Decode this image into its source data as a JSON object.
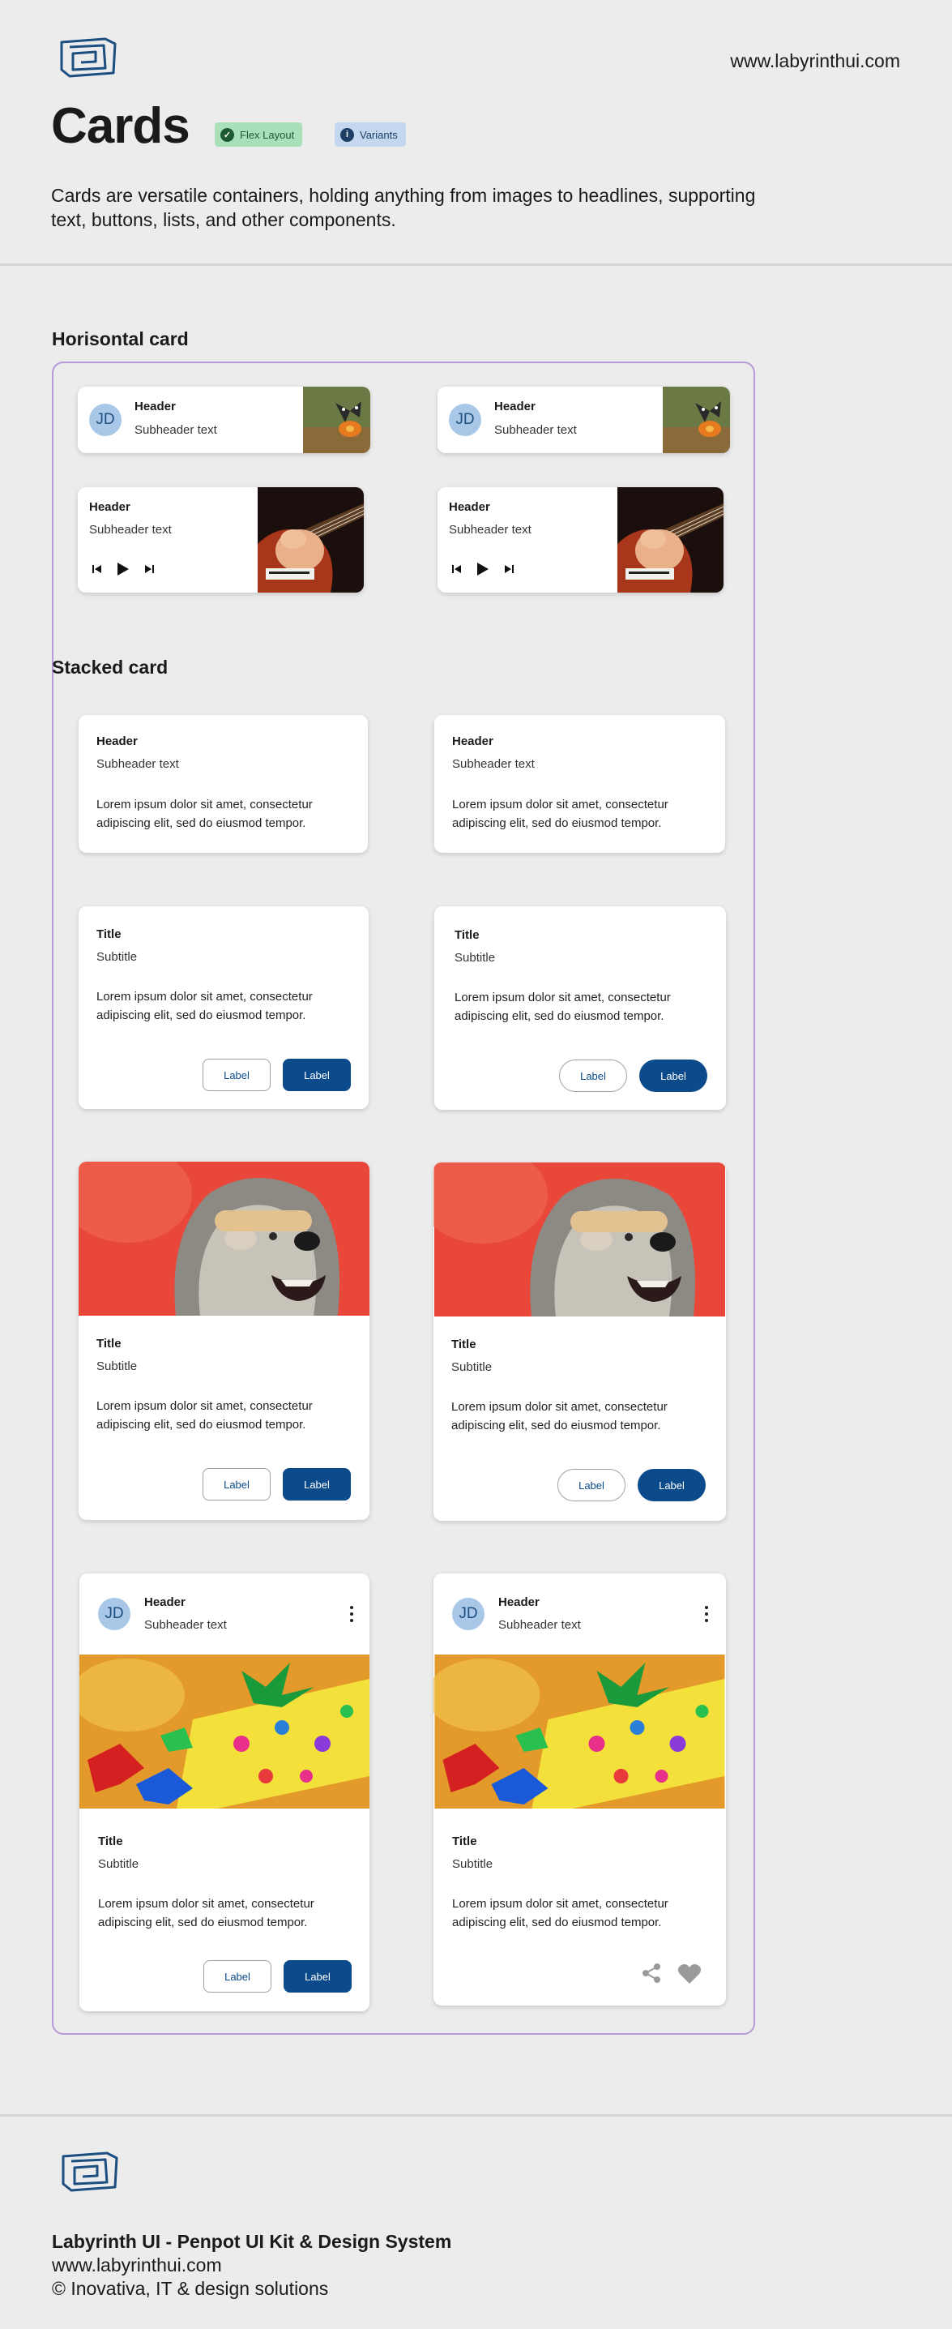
{
  "site": {
    "url": "www.labyrinthui.com",
    "logo_icon": "labyrinth-logo-icon"
  },
  "page": {
    "title": "Cards",
    "badges": [
      {
        "label": "Flex Layout",
        "icon": "check-circle-icon"
      },
      {
        "label": "Variants",
        "icon": "info-circle-icon"
      }
    ],
    "description": "Cards are versatile containers, holding anything from images to headlines, supporting text, buttons, lists, and other components."
  },
  "sections": {
    "horizontal": "Horisontal card",
    "stacked": "Stacked card"
  },
  "card": {
    "avatar": "JD",
    "header": "Header",
    "subheader": "Subheader text",
    "title": "Title",
    "subtitle": "Subtitle",
    "body": "Lorem ipsum dolor sit amet, consectetur adipiscing elit, sed do eiusmod tempor.",
    "button_outline": "Label",
    "button_filled": "Label"
  },
  "footer": {
    "line1": "Labyrinth UI  - Penpot UI Kit & Design System",
    "line2": "www.labyrinthui.com",
    "line3": "© Inovativa, IT & design solutions"
  },
  "colors": {
    "primary": "#0b4a8b",
    "frame": "#b79ad8",
    "avatar": "#a9c8e8",
    "flex_badge": "#a9dfb9",
    "variants_badge": "#c3d8ee"
  }
}
